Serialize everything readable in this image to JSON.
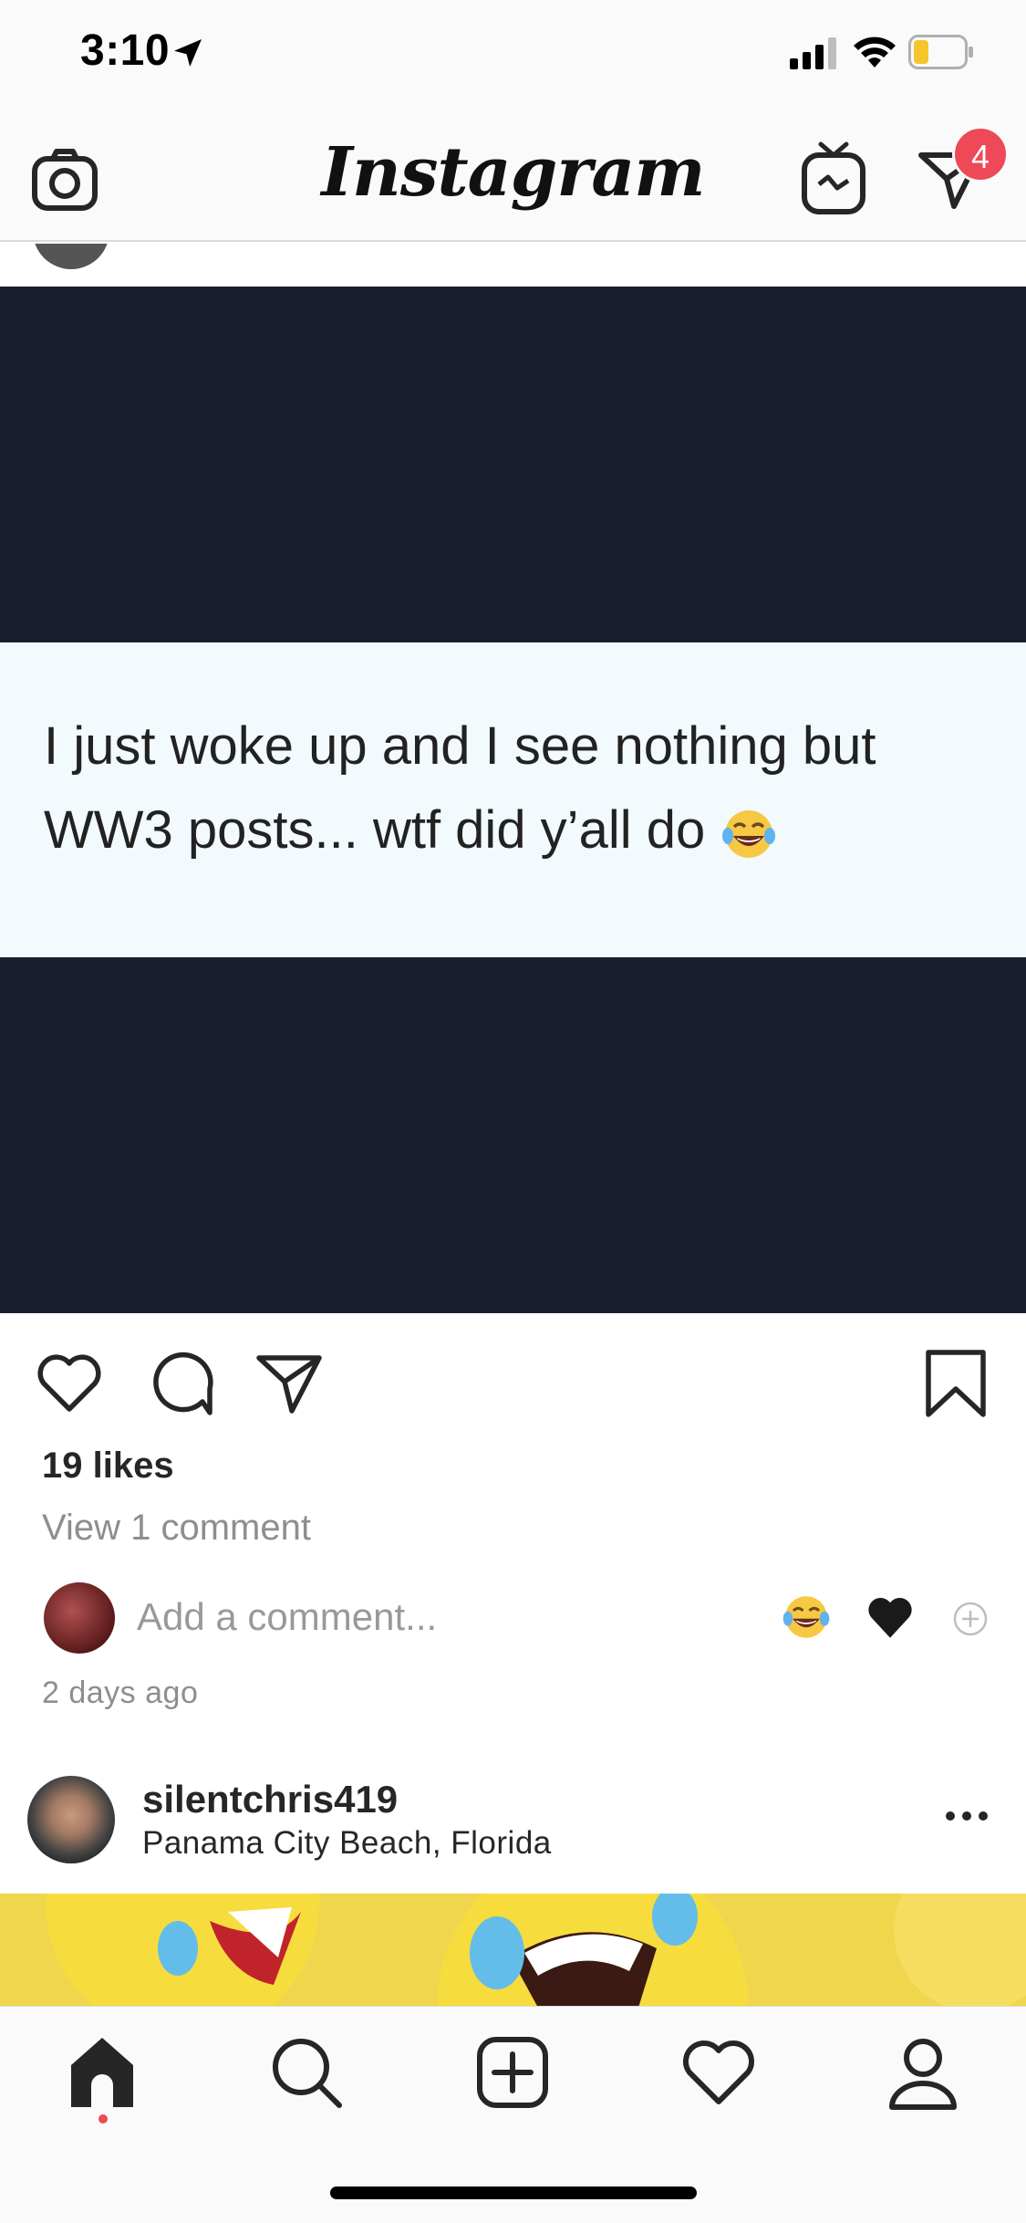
{
  "status_bar": {
    "time": "3:10",
    "icons": [
      "location-arrow-icon",
      "cellular-signal-icon",
      "wifi-icon",
      "battery-low-icon"
    ],
    "battery_color": "#f5c62b"
  },
  "header": {
    "title": "Instagram",
    "camera_icon": "camera-icon",
    "igtv_icon": "igtv-icon",
    "direct_icon": "direct-message-icon",
    "direct_badge": "4",
    "badge_color": "#ed4956"
  },
  "post": {
    "image_background": "#1a1d30",
    "image_text": "I just woke up and I see nothing but WW3 posts... wtf did y’all do",
    "image_text_emoji": "face-with-tears-of-joy",
    "actions": [
      "like-heart-icon",
      "comment-icon",
      "share-icon",
      "save-bookmark-icon"
    ],
    "likes": "19 likes",
    "view_comments": "View 1 comment",
    "comment_placeholder": "Add a comment...",
    "quick_reactions": [
      "face-with-tears-of-joy",
      "black-heart",
      "add-reaction-icon"
    ],
    "timestamp": "2 days ago"
  },
  "next_post": {
    "username": "silentchris419",
    "location": "Panama City Beach, Florida",
    "more_icon": "more-options-icon"
  },
  "tab_bar": {
    "tabs": [
      "home-icon",
      "search-icon",
      "new-post-icon",
      "activity-heart-icon",
      "profile-icon"
    ],
    "active": "home-icon"
  }
}
